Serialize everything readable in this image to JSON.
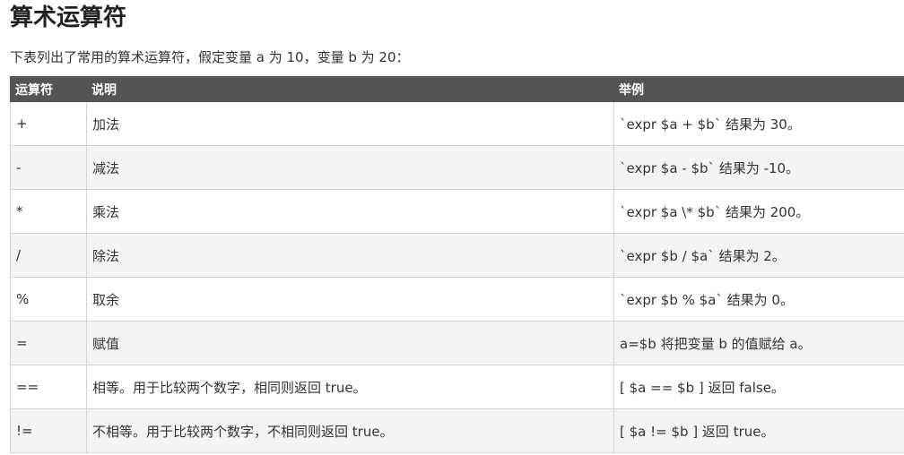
{
  "page": {
    "title": "算术运算符",
    "intro": "下表列出了常用的算术运算符，假定变量 a 为 10，变量 b 为 20："
  },
  "table": {
    "headers": [
      "运算符",
      "说明",
      "举例"
    ],
    "rows": [
      [
        "+",
        "加法",
        "`expr $a + $b` 结果为 30。"
      ],
      [
        "-",
        "减法",
        "`expr $a - $b` 结果为 -10。"
      ],
      [
        "*",
        "乘法",
        "`expr $a \\* $b` 结果为  200。"
      ],
      [
        "/",
        "除法",
        "`expr $b / $a` 结果为 2。"
      ],
      [
        "%",
        "取余",
        "`expr $b % $a` 结果为 0。"
      ],
      [
        "=",
        "赋值",
        "a=$b 将把变量 b 的值赋给 a。"
      ],
      [
        "==",
        "相等。用于比较两个数字，相同则返回 true。",
        "[ $a == $b ] 返回 false。"
      ],
      [
        "!=",
        "不相等。用于比较两个数字，不相同则返回 true。",
        "[ $a != $b ] 返回 true。"
      ]
    ]
  }
}
